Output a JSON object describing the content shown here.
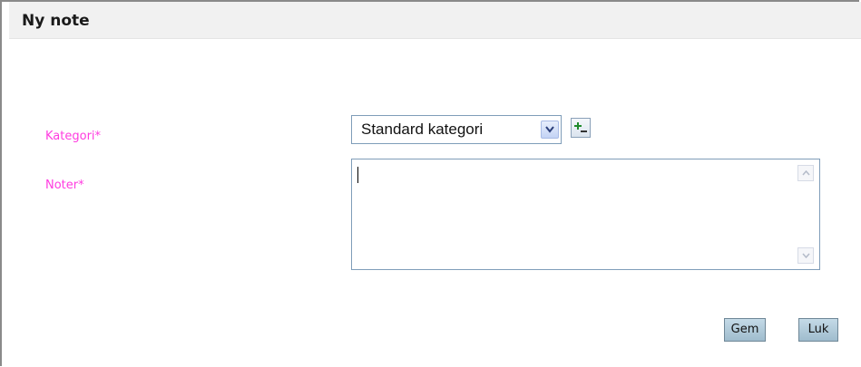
{
  "dialog": {
    "title": "Ny note"
  },
  "form": {
    "category_label": "Kategori*",
    "category_value": "Standard kategori",
    "notes_label": "Noter*",
    "notes_value": ""
  },
  "actions": {
    "save_label": "Gem",
    "close_label": "Luk"
  },
  "colors": {
    "label_color": "#ff3ce0",
    "button_bg": "#b3cddb",
    "field_border": "#7f9db9"
  },
  "icons": {
    "add_category": "add-category-icon",
    "dropdown": "chevron-down-icon",
    "scroll_up": "scroll-up-icon",
    "scroll_down": "scroll-down-icon"
  }
}
